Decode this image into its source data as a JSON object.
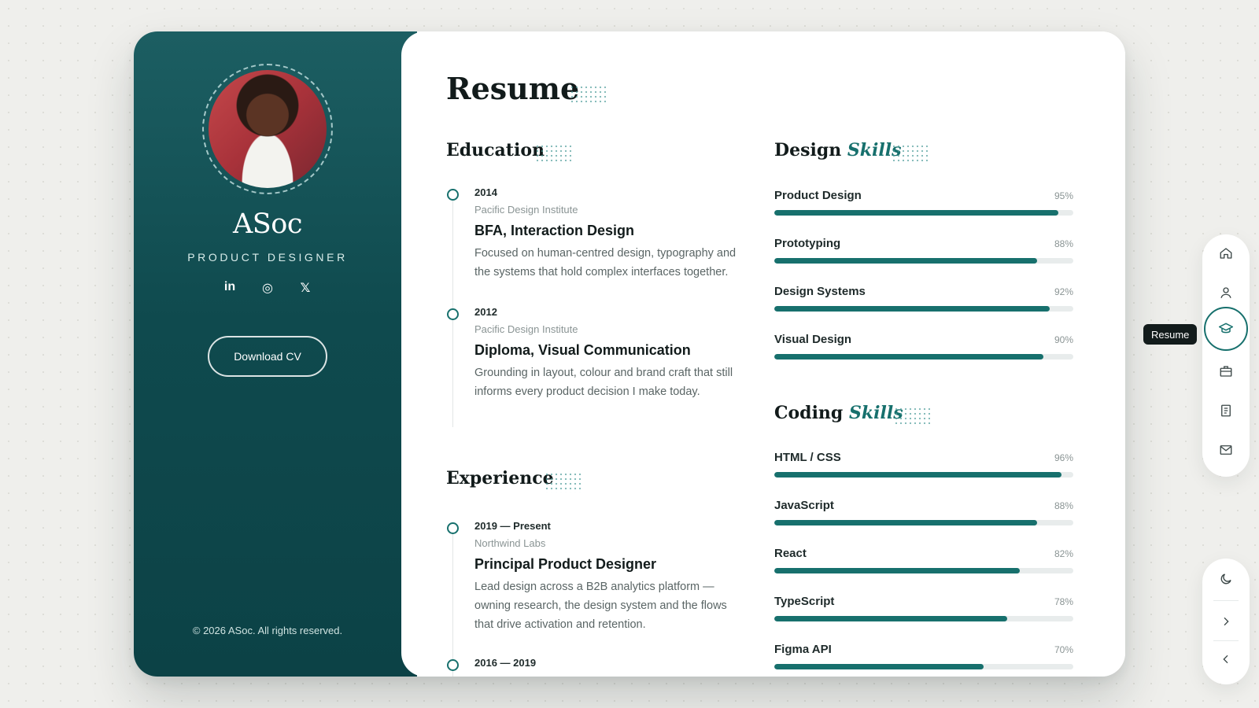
{
  "profile": {
    "name": "ASoc",
    "role": "PRODUCT DESIGNER",
    "socials": [
      {
        "label": "in",
        "icon": "linkedin-icon"
      },
      {
        "label": "◎",
        "icon": "dribbble-icon"
      },
      {
        "label": "𝕏",
        "icon": "x-icon"
      }
    ],
    "download_label": "Download CV",
    "copyright": "© 2026 ASoc. All rights reserved."
  },
  "page": {
    "title": "Resume"
  },
  "education": {
    "title": "Education",
    "items": [
      {
        "year": "2014",
        "org": "Pacific Design Institute",
        "title": "BFA, Interaction Design",
        "desc": "Focused on human-centred design, typography and the systems that hold complex interfaces together."
      },
      {
        "year": "2012",
        "org": "Pacific Design Institute",
        "title": "Diploma, Visual Communication",
        "desc": "Grounding in layout, colour and brand craft that still informs every product decision I make today."
      }
    ]
  },
  "experience": {
    "title": "Experience",
    "items": [
      {
        "year": "2019 — Present",
        "org": "Northwind Labs",
        "title": "Principal Product Designer",
        "desc": "Lead design across a B2B analytics platform — owning research, the design system and the flows that drive activation and retention."
      },
      {
        "year": "2016 — 2019",
        "org": "",
        "title": "",
        "desc": ""
      }
    ]
  },
  "design_skills": {
    "title_main": "Design",
    "title_accent": "Skills",
    "items": [
      {
        "name": "Product Design",
        "pct_label": "95%",
        "pct": 95
      },
      {
        "name": "Prototyping",
        "pct_label": "88%",
        "pct": 88
      },
      {
        "name": "Design Systems",
        "pct_label": "92%",
        "pct": 92
      },
      {
        "name": "Visual Design",
        "pct_label": "90%",
        "pct": 90
      }
    ]
  },
  "coding_skills": {
    "title_main": "Coding",
    "title_accent": "Skills",
    "items": [
      {
        "name": "HTML / CSS",
        "pct_label": "96%",
        "pct": 96
      },
      {
        "name": "JavaScript",
        "pct_label": "88%",
        "pct": 88
      },
      {
        "name": "React",
        "pct_label": "82%",
        "pct": 82
      },
      {
        "name": "TypeScript",
        "pct_label": "78%",
        "pct": 78
      },
      {
        "name": "Figma API",
        "pct_label": "70%",
        "pct": 70
      }
    ]
  },
  "nav": {
    "items": [
      {
        "icon": "home-icon",
        "active": false
      },
      {
        "icon": "user-icon",
        "active": false
      },
      {
        "icon": "graduation-cap-icon",
        "active": true
      },
      {
        "icon": "briefcase-icon",
        "active": false
      },
      {
        "icon": "document-icon",
        "active": false
      },
      {
        "icon": "mail-icon",
        "active": false
      }
    ],
    "tooltip": "Resume",
    "utility": [
      {
        "icon": "moon-icon"
      },
      {
        "icon": "chevron-right-icon"
      },
      {
        "icon": "chevron-left-icon"
      }
    ]
  },
  "colors": {
    "accent": "#17706d",
    "sidebar": "#0f4a4e",
    "background": "#efefec"
  }
}
